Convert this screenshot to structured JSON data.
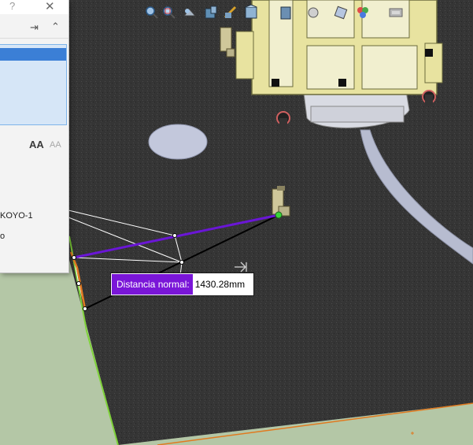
{
  "panel": {
    "help_glyph": "?",
    "close_glyph": "✕",
    "pin_glyph": "⇥",
    "collapse_glyph": "⌃",
    "font_large": "AA",
    "font_small": "AA",
    "entity_label": "KOYO-1",
    "entity_label2": "o"
  },
  "measure": {
    "label": "Distancia normal:",
    "value": "1430.28mm"
  },
  "toolbar": {
    "icons": [
      "zoom-to-fit-icon",
      "zoom-area-icon",
      "previous-view-icon",
      "section-view-icon",
      "dynamic-annotation-icon",
      "view-orientation-icon",
      "display-style-icon",
      "hide-show-icon",
      "edit-appearance-icon",
      "apply-scene-icon",
      "view-settings-icon"
    ]
  },
  "colors": {
    "floor": "#3a3a3a",
    "ground": "#b4c7a6",
    "measure_line": "#6a16d6",
    "measure_label_bg": "#7a16d8",
    "cart_frame": "#e8e3a0",
    "selection": "#3b7fd6"
  }
}
